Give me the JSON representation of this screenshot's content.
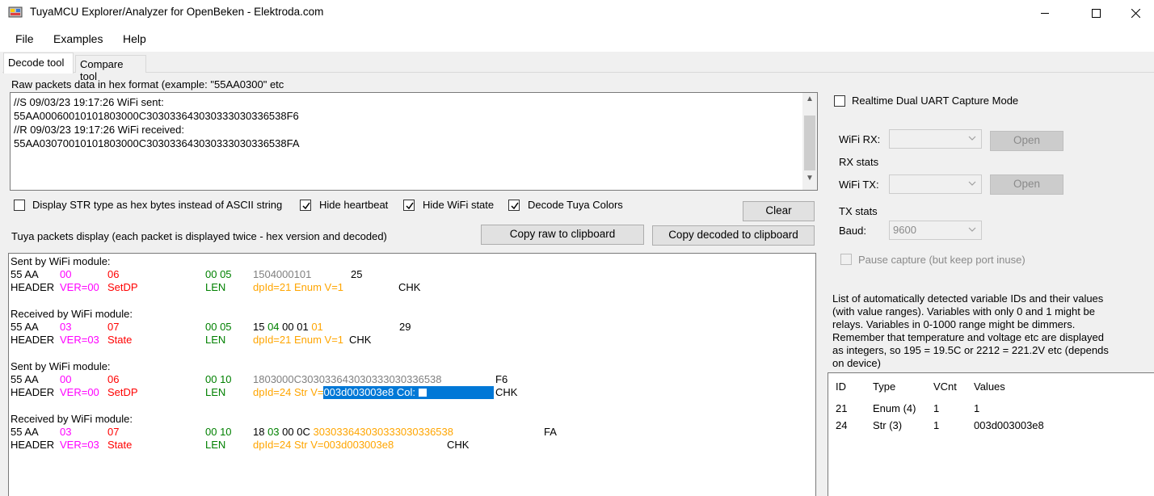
{
  "window": {
    "title": "TuyaMCU Explorer/Analyzer for OpenBeken - Elektroda.com"
  },
  "menu": {
    "file": "File",
    "examples": "Examples",
    "help": "Help"
  },
  "tabs": {
    "decode": "Decode tool",
    "compare": "Compare tool"
  },
  "raw": {
    "label": "Raw packets data in hex format (example: \"55AA0300\" etc",
    "lines": [
      "//S 09/03/23 19:17:26 WiFi sent:",
      "55AA00060010101803000C303033643030333030336538F6",
      "//R 09/03/23 19:17:26 WiFi received:",
      "55AA03070010101803000C303033643030333030336538FA"
    ]
  },
  "options": {
    "display_str_hex": "Display STR type as hex bytes instead of ASCII string",
    "hide_heartbeat": "Hide heartbeat",
    "hide_wifi_state": "Hide WiFi state",
    "decode_tuya_colors": "Decode Tuya Colors",
    "clear": "Clear",
    "packets_label": "Tuya packets display (each packet is displayed twice - hex version and decoded)",
    "copy_raw": "Copy raw to clipboard",
    "copy_decoded": "Copy decoded to clipboard"
  },
  "packets": [
    {
      "title": "Sent by WiFi module:",
      "hex_head": "55 AA",
      "hex_ver": "00",
      "hex_cmd": "06",
      "hex_len": "00 05",
      "hex_data": [
        {
          "t": "1504000101",
          "c": "gray"
        }
      ],
      "hex_chk": "25",
      "dec_head": "HEADER",
      "dec_ver": "VER=00",
      "dec_cmd": "SetDP",
      "dec_len": "LEN",
      "dec_data": "dpId=21 Enum V=1",
      "dec_chk": "CHK"
    },
    {
      "title": "Received by WiFi module:",
      "hex_head": "55 AA",
      "hex_ver": "03",
      "hex_cmd": "07",
      "hex_len": "00 05",
      "hex_data": [
        {
          "t": "15 ",
          "c": "black"
        },
        {
          "t": "04",
          "c": "green"
        },
        {
          "t": " 00 01 ",
          "c": "black"
        },
        {
          "t": "01",
          "c": "orange"
        }
      ],
      "hex_chk": "29",
      "dec_head": "HEADER",
      "dec_ver": "VER=03",
      "dec_cmd": "State",
      "dec_len": "LEN",
      "dec_data": "dpId=21 Enum V=1",
      "dec_chk": "CHK"
    },
    {
      "title": "Sent by WiFi module:",
      "hex_head": "55 AA",
      "hex_ver": "00",
      "hex_cmd": "06",
      "hex_len": "00 10",
      "hex_data": [
        {
          "t": "1803000C303033643030333030336538",
          "c": "gray"
        }
      ],
      "hex_chk": "F6",
      "dec_head": "HEADER",
      "dec_ver": "VER=00",
      "dec_cmd": "SetDP",
      "dec_len": "LEN",
      "dec_data": "dpId=24 Str V=",
      "dec_sel": "003d003003e8 Col: ",
      "dec_chk": "CHK"
    },
    {
      "title": "Received by WiFi module:",
      "hex_head": "55 AA",
      "hex_ver": "03",
      "hex_cmd": "07",
      "hex_len": "00 10",
      "hex_data": [
        {
          "t": "18 ",
          "c": "black"
        },
        {
          "t": "03",
          "c": "green"
        },
        {
          "t": " 00 0C ",
          "c": "black"
        },
        {
          "t": "303033643030333030336538",
          "c": "orange"
        }
      ],
      "hex_chk": "FA",
      "dec_head": "HEADER",
      "dec_ver": "VER=03",
      "dec_cmd": "State",
      "dec_len": "LEN",
      "dec_data": "dpId=24 Str V=003d003003e8",
      "dec_chk": "CHK"
    }
  ],
  "uart": {
    "realtime_label": "Realtime Dual UART Capture Mode",
    "wifi_rx": "WiFi RX:",
    "open_rx": "Open",
    "rx_stats": "RX stats",
    "wifi_tx": "WiFi TX:",
    "open_tx": "Open",
    "tx_stats": "TX stats",
    "baud_label": "Baud:",
    "baud_value": "9600",
    "pause_label": "Pause capture (but keep port inuse)"
  },
  "vars": {
    "description": [
      "List of automatically detected variable IDs  and their values",
      "(with value ranges). Variables with only 0 and 1 might be",
      "relays. Variables in 0-1000 range might be dimmers.",
      "Remember that temperature and voltage etc are displayed",
      "as integers, so 195 = 19.5C or 2212 = 221.2V etc (depends",
      "on device)"
    ],
    "columns": [
      "ID",
      "Type",
      "VCnt",
      "Values"
    ],
    "rows": [
      [
        "21",
        "Enum (4)",
        "1",
        "1"
      ],
      [
        "24",
        "Str (3)",
        "1",
        "003d003003e8"
      ]
    ]
  },
  "colors": {
    "magenta": "#ff00ff",
    "red": "#ff0000",
    "green": "#008000",
    "gray": "#808080",
    "orange": "#ffa500",
    "selection": "#0078d7"
  }
}
